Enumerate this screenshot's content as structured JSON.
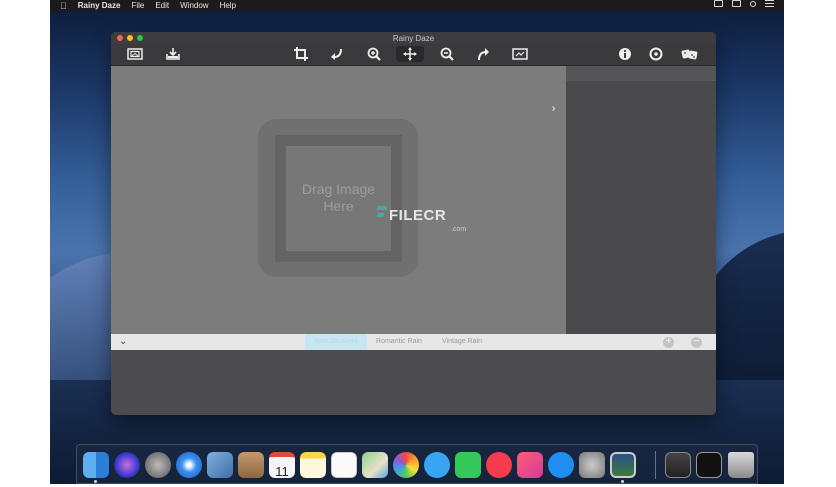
{
  "menubar": {
    "app_name": "Rainy Daze",
    "items": [
      "File",
      "Edit",
      "Window",
      "Help"
    ]
  },
  "window": {
    "title": "Rainy Daze",
    "drop_text_line1": "Drag Image",
    "drop_text_line2": "Here"
  },
  "watermark": {
    "text": "FILECR",
    "suffix": ".com"
  },
  "toolbar": {
    "icons": [
      "open-image-icon",
      "save-image-icon",
      "crop-icon",
      "rotate-left-icon",
      "zoom-in-icon",
      "pan-icon",
      "zoom-out-icon",
      "redo-icon",
      "fit-image-icon",
      "info-icon",
      "settings-icon",
      "random-icon"
    ],
    "active": "pan-icon"
  },
  "presets": {
    "tabs": [
      "Bath Showers",
      "Romantic Rain",
      "Vintage Rain"
    ],
    "selected": "Bath Showers"
  },
  "dock": {
    "apps": [
      "finder",
      "siri",
      "launchpad",
      "safari",
      "mail",
      "contacts",
      "calendar",
      "notes",
      "reminders",
      "maps",
      "photos",
      "messages",
      "facetime",
      "news",
      "music",
      "app-store",
      "system-preferences",
      "rainy-daze",
      "photo-viewer",
      "screen-sharing",
      "trash"
    ],
    "calendar_day": "11"
  },
  "colors": {
    "accent_selected_tab": "#c8e6f1",
    "watermark_teal": "#4fa3a0"
  }
}
